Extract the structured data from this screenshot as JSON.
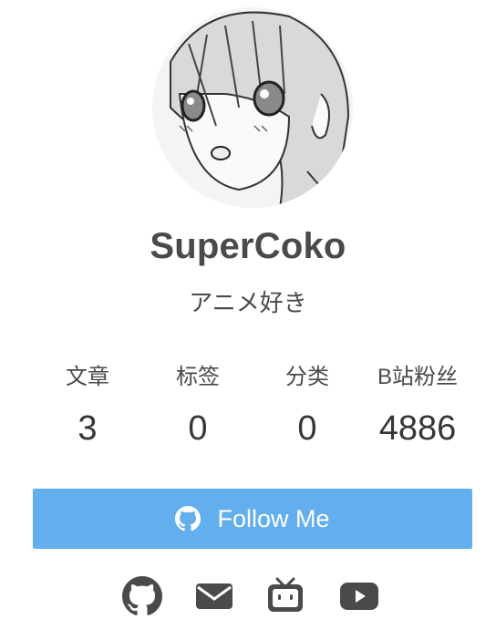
{
  "profile": {
    "name": "SuperCoko",
    "description": "アニメ好き"
  },
  "stats": [
    {
      "label": "文章",
      "value": "3"
    },
    {
      "label": "标签",
      "value": "0"
    },
    {
      "label": "分类",
      "value": "0"
    },
    {
      "label": "B站粉丝",
      "value": "4886"
    }
  ],
  "follow_button": {
    "label": "Follow Me",
    "icon": "github-icon",
    "color": "#63aeed"
  },
  "social_links": [
    {
      "icon": "github-icon"
    },
    {
      "icon": "email-icon"
    },
    {
      "icon": "bilibili-icon"
    },
    {
      "icon": "youtube-icon"
    }
  ],
  "colors": {
    "text": "#4a4a4a",
    "accent": "#63aeed",
    "icon": "#4a4a4a"
  }
}
